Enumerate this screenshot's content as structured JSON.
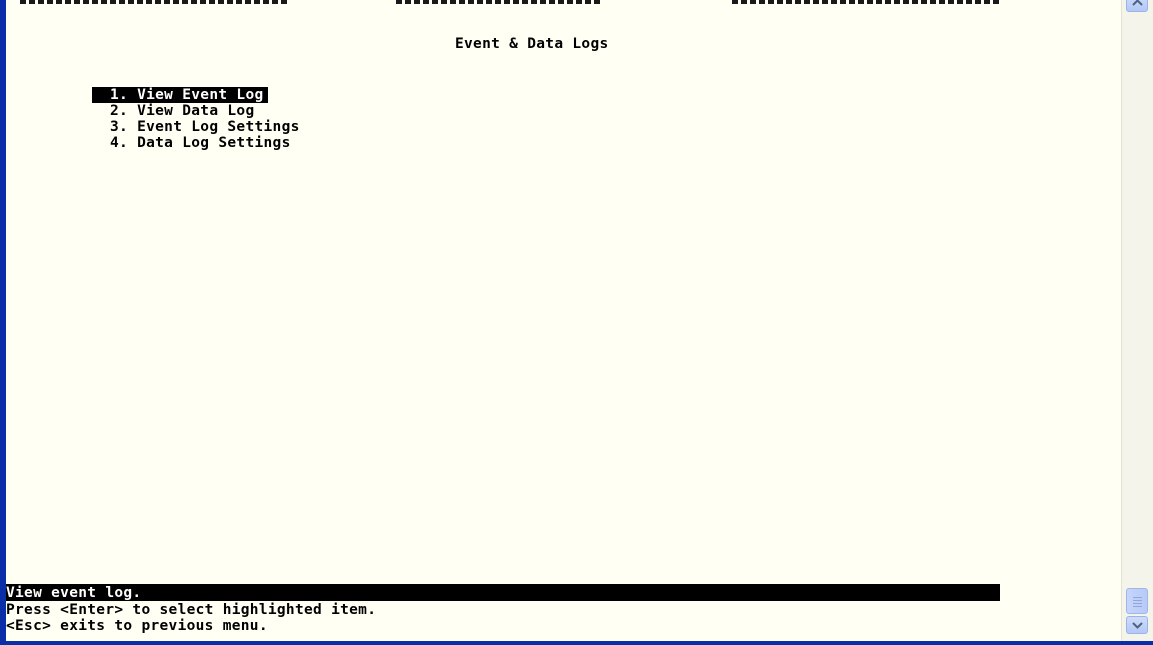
{
  "title": "Event & Data Logs",
  "menu": [
    {
      "label": "1. View Event Log",
      "selected": true
    },
    {
      "label": "2. View Data Log",
      "selected": false
    },
    {
      "label": "3. Event Log Settings",
      "selected": false
    },
    {
      "label": "4. Data Log Settings",
      "selected": false
    }
  ],
  "status": {
    "description": "View event log.",
    "hint_enter": "Press <Enter> to select highlighted item.",
    "hint_esc": "<Esc> exits to previous menu."
  },
  "colors": {
    "background": "#fffff4",
    "text": "#000000",
    "highlight_bg": "#000000",
    "highlight_text": "#ffffff",
    "window_frame": "#0a2ea8"
  },
  "icons": {
    "scroll_up": "scroll-up-arrow-icon",
    "scroll_down": "scroll-down-arrow-icon"
  }
}
